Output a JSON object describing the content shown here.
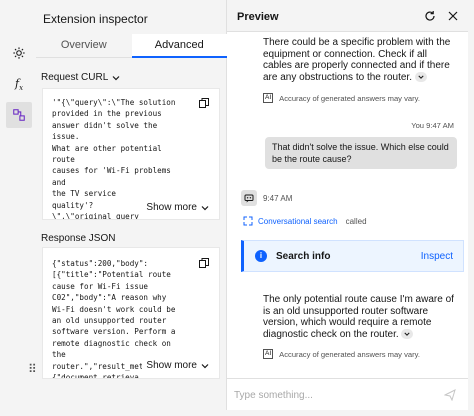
{
  "rail": {
    "items": [
      {
        "name": "settings-gear"
      },
      {
        "name": "function"
      },
      {
        "name": "extension-inspector"
      }
    ]
  },
  "inspector": {
    "title": "Extension inspector",
    "tabs": [
      {
        "label": "Overview",
        "active": false
      },
      {
        "label": "Advanced",
        "active": true
      }
    ],
    "request_label": "Request CURL",
    "request_code": "'\"{\\\"query\\\":\\\"The solution\nprovided in the previous\nanswer didn't solve the\nissue.\nWhat are other potential\nroute\ncauses for 'Wi-Fi problems\nand\nthe TV service\nquality'?\n\\\",\\\"original_query",
    "response_label": "Response JSON",
    "response_code": "{\"status\":200,\"body\":\n[{\"title\":\"Potential route\ncause for Wi-Fi issue\nC02\",\"body\":\"A reason why\nWi-Fi doesn't work could be\nan old unsupported router\nsoftware version. Perform a\nremote diagnostic check on\nthe\nrouter.\",\"result_metadata\":\n{\"document_retrieva",
    "show_more_label": "Show more"
  },
  "preview": {
    "title": "Preview",
    "bot_message_1": "There could be a specific problem with the equipment or connection. Check if all cables are properly connected and if there are any obstructions to the router.",
    "disclaimer": "Accuracy of generated answers may vary.",
    "ai_badge": "AI",
    "user_meta": "You 9:47 AM",
    "user_message": "That didn't solve the issue. Which else could be the route cause?",
    "bot_time": "9:47 AM",
    "extension_link": "Conversational search",
    "extension_called": "called",
    "search_card_title": "Search info",
    "search_card_action": "Inspect",
    "bot_message_2": "The only potential route cause I'm aware of is an old unsupported router software version, which would require a remote diagnostic check on the router.",
    "input_placeholder": "Type something...",
    "input_value": ""
  },
  "colors": {
    "accent": "#0f62fe",
    "panel_bg": "#f4f4f4",
    "bubble_bg": "#e0e0e0",
    "card_bg": "#edf5ff"
  },
  "icons": [
    "gear-icon",
    "function-icon",
    "inspector-icon",
    "drag-handle-icon",
    "copy-icon",
    "chevron-down-icon",
    "refresh-icon",
    "close-icon",
    "ai-icon",
    "bot-icon",
    "extension-icon",
    "info-icon",
    "send-icon"
  ]
}
